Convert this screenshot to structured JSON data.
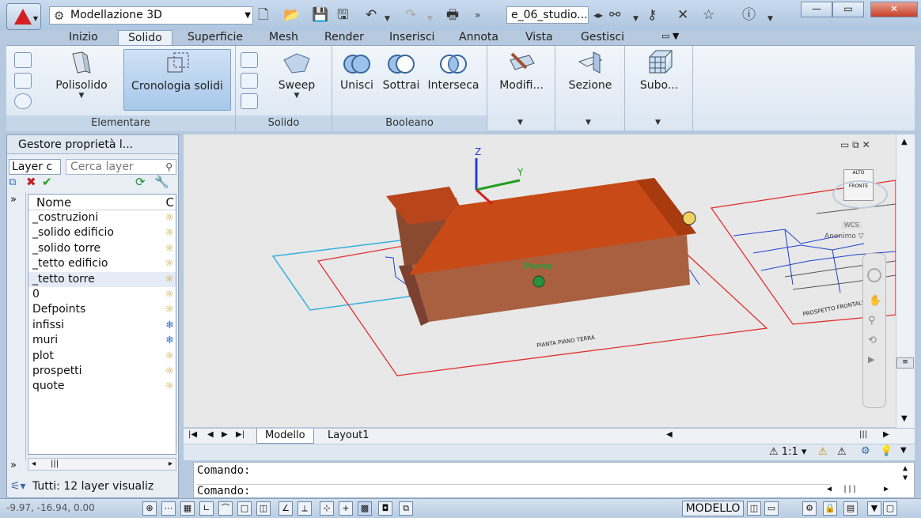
{
  "titlebar": {
    "workspace": "Modellazione 3D",
    "filename": "e_06_studio...",
    "win_minimize": "—",
    "win_restore": "▭",
    "win_close": "✕"
  },
  "ribbon_tabs": [
    "Inizio",
    "Solido",
    "Superficie",
    "Mesh",
    "Render",
    "Inserisci",
    "Annota",
    "Vista",
    "Gestisci"
  ],
  "active_tab": "Solido",
  "ribbon": {
    "polisolido": "Polisolido",
    "cronologia": "Cronologia solidi",
    "sweep": "Sweep",
    "unisci": "Unisci",
    "sottrai": "Sottrai",
    "interseca": "Interseca",
    "modifi": "Modifi...",
    "sezione": "Sezione",
    "subo": "Subo...",
    "panel_elementare": "Elementare",
    "panel_solido": "Solido",
    "panel_booleano": "Booleano"
  },
  "palette": {
    "title": "Gestore proprietà l...",
    "layer_tab": "Layer c",
    "search_placeholder": "Cerca layer",
    "col_name": "Nome",
    "col_c": "C",
    "layers": [
      "_costruzioni",
      "_solido edificio",
      "_solido torre",
      "_tetto edificio",
      "_tetto torre",
      "0",
      "Defpoints",
      "infissi",
      "muri",
      "plot",
      "prospetti",
      "quote"
    ],
    "selected_layer": "_tetto torre",
    "status": "Tutti: 12 layer visualiz"
  },
  "viewport": {
    "pivot_label": "Perno",
    "plan_label": "PIANTA PIANO TERRA",
    "prospect_label": "PROSPETTO FRONTALE",
    "viewcube_top": "ALTO",
    "viewcube_front": "FRONTE",
    "wcs": "WCS",
    "ucs_name": "Anonimo"
  },
  "layout_tabs": [
    "Modello",
    "Layout1"
  ],
  "active_layout": "Modello",
  "scale": "1:1",
  "command": {
    "line1": "Comando:",
    "line2": "Comando:"
  },
  "statusbar": {
    "coords": "-9.97, -16.94, 0.00",
    "space": "MODELLO"
  },
  "colors": {
    "roof": "#c84a16",
    "walls": "#a86040",
    "plan_red": "#e03030",
    "plan_cyan": "#30b0e0",
    "ribbon_bg": "#e4edf7"
  }
}
